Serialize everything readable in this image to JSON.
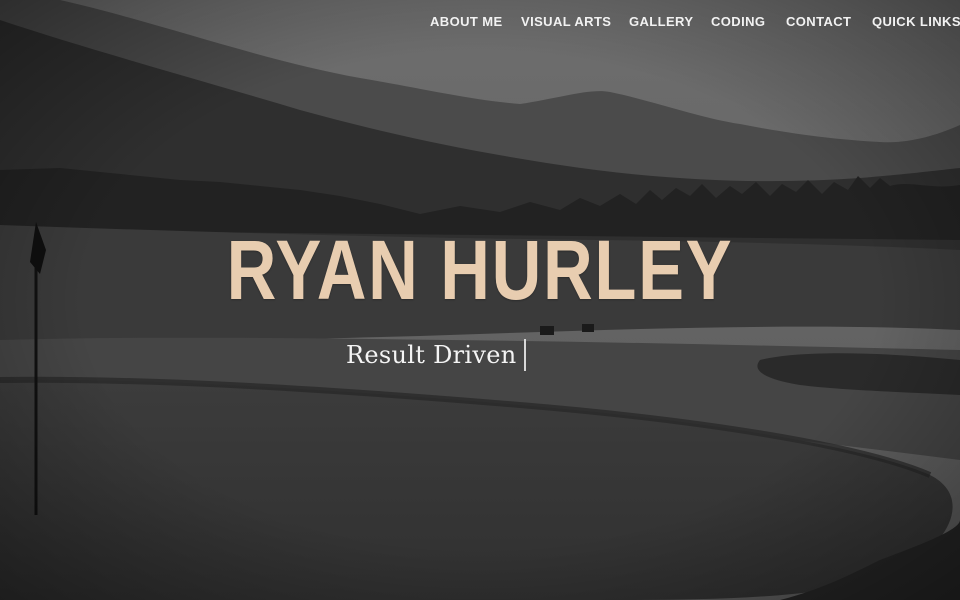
{
  "nav": {
    "items": [
      {
        "label": "ABOUT ME"
      },
      {
        "label": "VISUAL ARTS"
      },
      {
        "label": "GALLERY"
      },
      {
        "label": "CODING"
      },
      {
        "label": "CONTACT"
      },
      {
        "label": "QUICK LINKS",
        "has_dropdown": true
      }
    ],
    "dropdown_icon": "chevron-down-icon"
  },
  "hero": {
    "name": "RYAN HURLEY",
    "tagline": "Result Driven",
    "background_description_icon": "golf-course-landscape",
    "colors": {
      "name": "#e8cdb0",
      "tagline": "#f4f4f4",
      "nav_text": "#f2f2f2"
    }
  }
}
